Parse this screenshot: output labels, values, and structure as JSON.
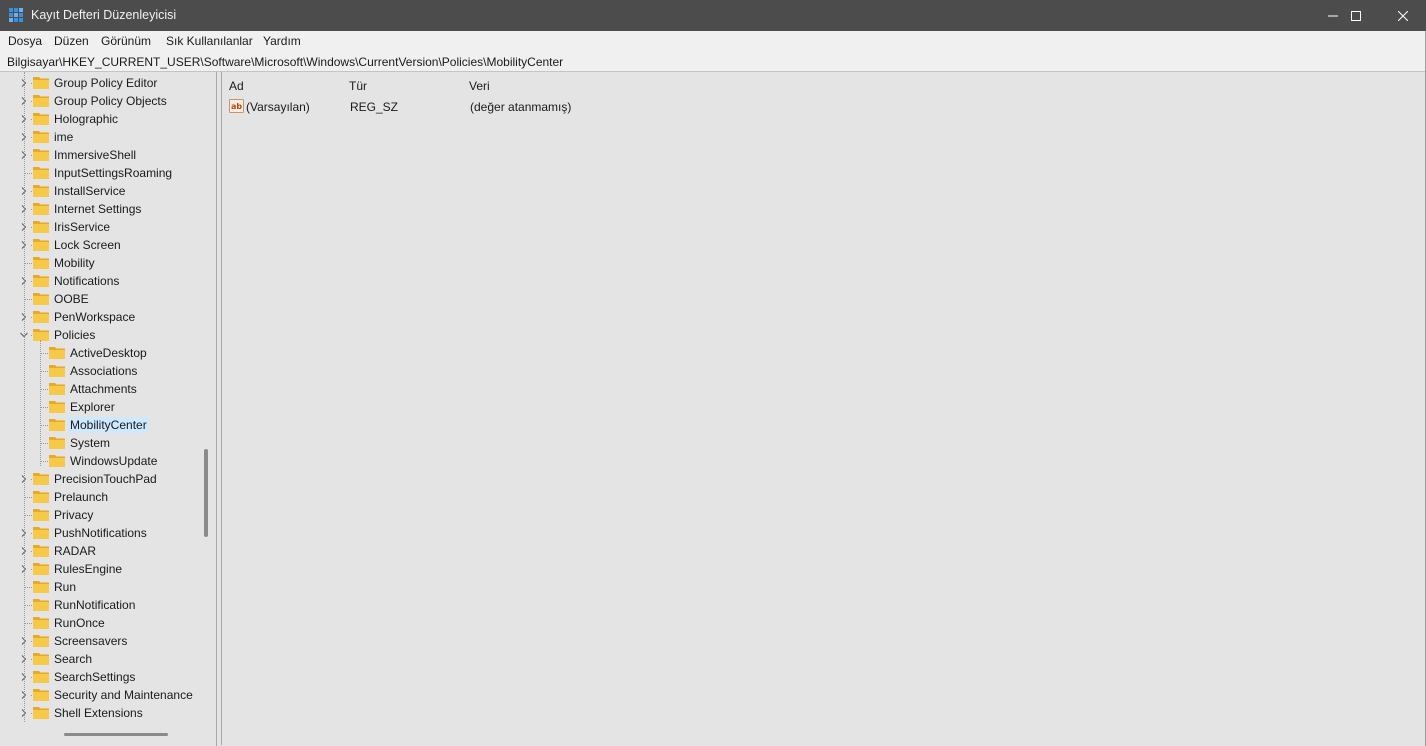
{
  "window": {
    "title": "Kayıt Defteri Düzenleyicisi",
    "icon": "registry-editor-icon",
    "controls": [
      "minimize-icon",
      "maximize-icon",
      "close-icon"
    ]
  },
  "menu": [
    "Dosya",
    "Düzen",
    "Görünüm",
    "Sık Kullanılanlar",
    "Yardım"
  ],
  "address": "Bilgisayar\\HKEY_CURRENT_USER\\Software\\Microsoft\\Windows\\CurrentVersion\\Policies\\MobilityCenter",
  "tree": [
    {
      "label": "Group Policy Editor",
      "level": 0,
      "expander": "collapsed"
    },
    {
      "label": "Group Policy Objects",
      "level": 0,
      "expander": "collapsed"
    },
    {
      "label": "Holographic",
      "level": 0,
      "expander": "collapsed"
    },
    {
      "label": "ime",
      "level": 0,
      "expander": "collapsed"
    },
    {
      "label": "ImmersiveShell",
      "level": 0,
      "expander": "collapsed"
    },
    {
      "label": "InputSettingsRoaming",
      "level": 0,
      "expander": "none"
    },
    {
      "label": "InstallService",
      "level": 0,
      "expander": "collapsed"
    },
    {
      "label": "Internet Settings",
      "level": 0,
      "expander": "collapsed"
    },
    {
      "label": "IrisService",
      "level": 0,
      "expander": "collapsed"
    },
    {
      "label": "Lock Screen",
      "level": 0,
      "expander": "collapsed"
    },
    {
      "label": "Mobility",
      "level": 0,
      "expander": "none"
    },
    {
      "label": "Notifications",
      "level": 0,
      "expander": "collapsed"
    },
    {
      "label": "OOBE",
      "level": 0,
      "expander": "none"
    },
    {
      "label": "PenWorkspace",
      "level": 0,
      "expander": "collapsed"
    },
    {
      "label": "Policies",
      "level": 0,
      "expander": "expanded"
    },
    {
      "label": "ActiveDesktop",
      "level": 1,
      "expander": "none"
    },
    {
      "label": "Associations",
      "level": 1,
      "expander": "none"
    },
    {
      "label": "Attachments",
      "level": 1,
      "expander": "none"
    },
    {
      "label": "Explorer",
      "level": 1,
      "expander": "none"
    },
    {
      "label": "MobilityCenter",
      "level": 1,
      "expander": "none",
      "selected": true
    },
    {
      "label": "System",
      "level": 1,
      "expander": "none"
    },
    {
      "label": "WindowsUpdate",
      "level": 1,
      "expander": "none"
    },
    {
      "label": "PrecisionTouchPad",
      "level": 0,
      "expander": "collapsed"
    },
    {
      "label": "Prelaunch",
      "level": 0,
      "expander": "none"
    },
    {
      "label": "Privacy",
      "level": 0,
      "expander": "none"
    },
    {
      "label": "PushNotifications",
      "level": 0,
      "expander": "collapsed"
    },
    {
      "label": "RADAR",
      "level": 0,
      "expander": "collapsed"
    },
    {
      "label": "RulesEngine",
      "level": 0,
      "expander": "collapsed"
    },
    {
      "label": "Run",
      "level": 0,
      "expander": "none"
    },
    {
      "label": "RunNotification",
      "level": 0,
      "expander": "none"
    },
    {
      "label": "RunOnce",
      "level": 0,
      "expander": "none"
    },
    {
      "label": "Screensavers",
      "level": 0,
      "expander": "collapsed"
    },
    {
      "label": "Search",
      "level": 0,
      "expander": "collapsed"
    },
    {
      "label": "SearchSettings",
      "level": 0,
      "expander": "collapsed"
    },
    {
      "label": "Security and Maintenance",
      "level": 0,
      "expander": "collapsed"
    },
    {
      "label": "Shell Extensions",
      "level": 0,
      "expander": "collapsed"
    }
  ],
  "list": {
    "columns": [
      "Ad",
      "Tür",
      "Veri"
    ],
    "rows": [
      {
        "icon": "string-value-icon",
        "name": "(Varsayılan)",
        "type": "REG_SZ",
        "data": "(değer atanmamış)"
      }
    ]
  },
  "colors": {
    "titlebar": "#4c4c4c",
    "background": "#e4e4e4",
    "menubar": "#f0f0f0",
    "folder": "#f7c948",
    "selection": "#cde8ff"
  }
}
